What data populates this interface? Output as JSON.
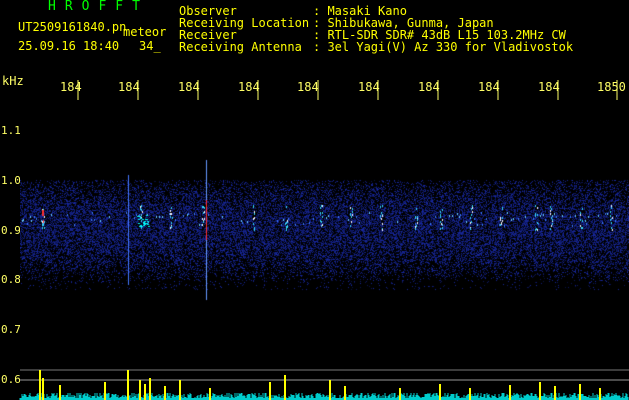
{
  "header": {
    "app_title": "HROFFT",
    "filename": "UT2509161840.pn",
    "filename_suffix": "meteor",
    "datetime": "25.09.16 18:40",
    "count": "34_",
    "fields": [
      {
        "label": "Observer",
        "value": ": Masaki Kano"
      },
      {
        "label": "Receiving Location",
        "value": ": Shibukawa, Gunma, Japan"
      },
      {
        "label": "Receiver",
        "value": ": RTL-SDR SDR# 43dB L15 103.2MHz CW"
      },
      {
        "label": "Receiving Antenna",
        "value": ": 3el Yagi(V) Az 330 for Vladivostok"
      }
    ]
  },
  "x_axis": {
    "ticks": [
      "184",
      "184",
      "184",
      "184",
      "184",
      "184",
      "184",
      "184",
      "184",
      "1850"
    ]
  },
  "y_axis": {
    "unit": "kHz",
    "ticks": [
      "1.1",
      "1.0",
      "0.9",
      "0.8",
      "0.7",
      "0.6"
    ]
  },
  "colors": {
    "title": "#00ff00",
    "text": "#ffff00",
    "noise": "#1a2a9a",
    "signal": "#00ccff",
    "hot": "#ff3030",
    "graph": "#ffff00",
    "graph_base": "#00cccc"
  }
}
